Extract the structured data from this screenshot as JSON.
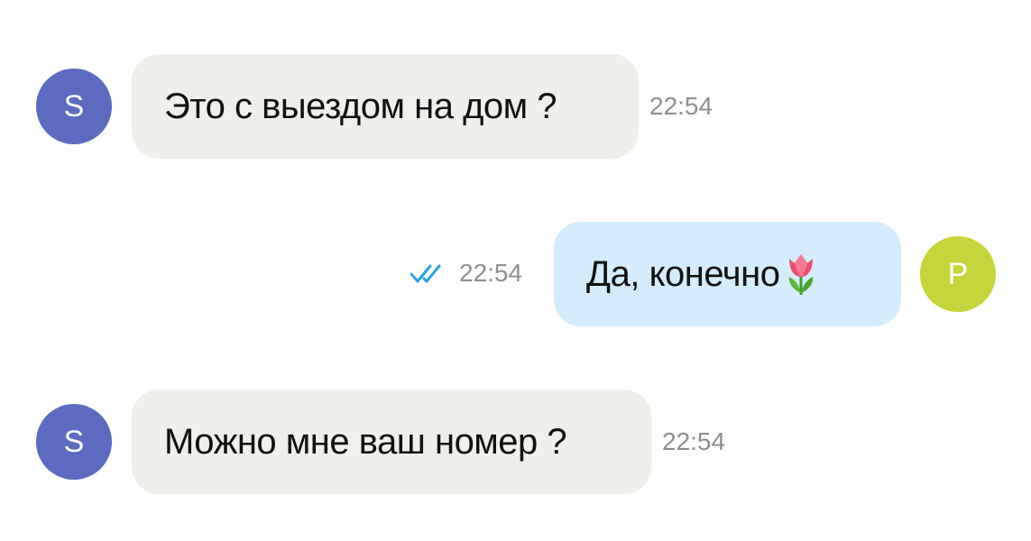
{
  "colors": {
    "avatar_s": "#5c6bc0",
    "avatar_p": "#c6d63a",
    "incoming_bubble": "#f1efea",
    "outgoing_bubble": "#d4ecfb",
    "read_checks": "#2ea0e6",
    "timestamp": "#8f8f8f"
  },
  "messages": [
    {
      "direction": "incoming",
      "avatar_letter": "S",
      "text": "Это с выездом на дом ?",
      "time": "22:54"
    },
    {
      "direction": "outgoing",
      "avatar_letter": "P",
      "text": "Да, конечно",
      "emoji_icon": "tulip-icon",
      "status_icon": "double-check-read-icon",
      "time": "22:54"
    },
    {
      "direction": "incoming",
      "avatar_letter": "S",
      "text": "Можно мне ваш номер ?",
      "time": "22:54"
    }
  ]
}
